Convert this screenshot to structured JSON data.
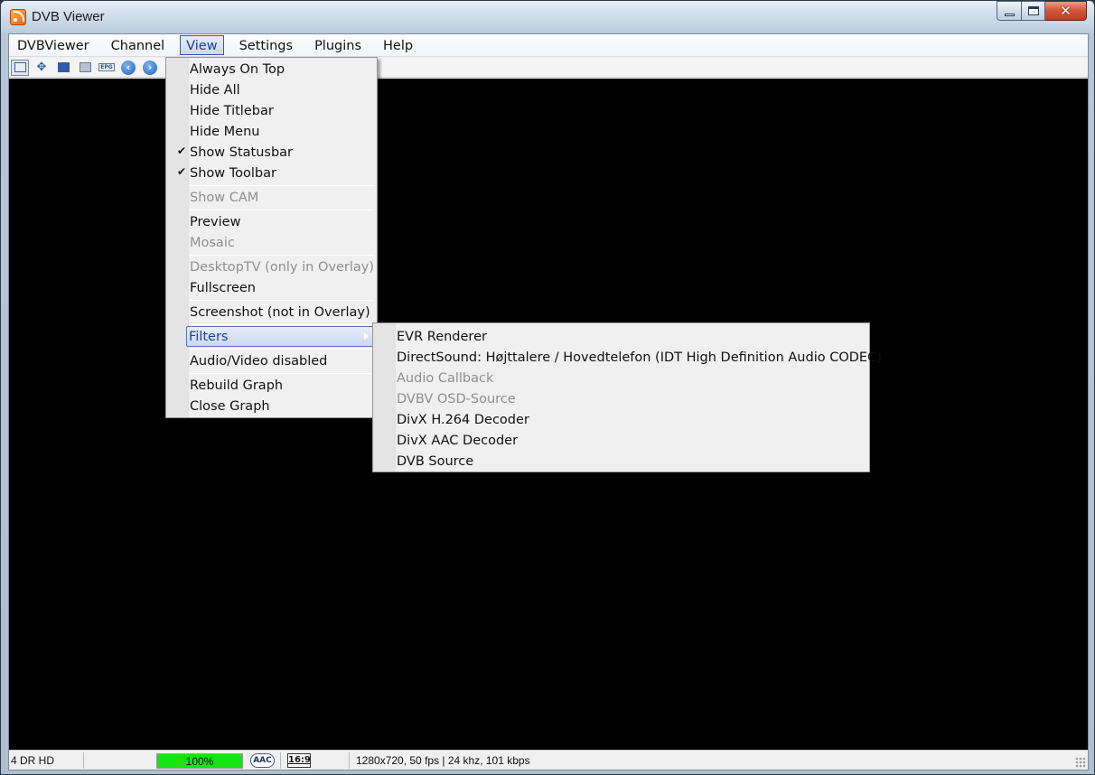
{
  "window": {
    "title": "DVB Viewer",
    "close_glyph": "✕"
  },
  "menubar": {
    "items": [
      {
        "label": "DVBViewer"
      },
      {
        "label": "Channel"
      },
      {
        "label": "View"
      },
      {
        "label": "Settings"
      },
      {
        "label": "Plugins"
      },
      {
        "label": "Help"
      }
    ]
  },
  "toolbar": {
    "epg_label": "EPG",
    "back_glyph": "‹",
    "forward_glyph": "›"
  },
  "view_menu": {
    "items": [
      {
        "label": "Always On Top",
        "checked": false,
        "disabled": false
      },
      {
        "label": "Hide All",
        "checked": false,
        "disabled": false
      },
      {
        "label": "Hide Titlebar",
        "checked": false,
        "disabled": false
      },
      {
        "label": "Hide Menu",
        "checked": false,
        "disabled": false
      },
      {
        "label": "Show Statusbar",
        "checked": true,
        "disabled": false
      },
      {
        "label": "Show Toolbar",
        "checked": true,
        "disabled": false
      },
      {
        "label": "Show CAM",
        "checked": false,
        "disabled": true
      },
      {
        "label": "Preview",
        "checked": false,
        "disabled": false
      },
      {
        "label": "Mosaic",
        "checked": false,
        "disabled": true
      },
      {
        "label": "DesktopTV (only in Overlay)",
        "checked": false,
        "disabled": true
      },
      {
        "label": "Fullscreen",
        "checked": false,
        "disabled": false
      },
      {
        "label": "Screenshot (not in Overlay)",
        "checked": false,
        "disabled": false
      },
      {
        "label": "Filters",
        "checked": false,
        "disabled": false,
        "submenu": true,
        "highlighted": true
      },
      {
        "label": "Audio/Video disabled",
        "checked": false,
        "disabled": false
      },
      {
        "label": "Rebuild Graph",
        "checked": false,
        "disabled": false
      },
      {
        "label": "Close Graph",
        "checked": false,
        "disabled": false
      }
    ],
    "check_glyph": "✔"
  },
  "filters_menu": {
    "items": [
      {
        "label": "EVR Renderer",
        "disabled": false
      },
      {
        "label": "DirectSound: Højttalere / Hovedtelefon (IDT High Definition Audio CODEC)",
        "disabled": false
      },
      {
        "label": "Audio Callback",
        "disabled": true
      },
      {
        "label": "DVBV OSD-Source",
        "disabled": true
      },
      {
        "label": "DivX H.264 Decoder",
        "disabled": false
      },
      {
        "label": "DivX AAC Decoder",
        "disabled": false
      },
      {
        "label": "DVB Source",
        "disabled": false
      }
    ]
  },
  "statusbar": {
    "channel": "4 DR HD",
    "signal_percent": "100%",
    "signal_level": 1.0,
    "audio_badge": "AAC",
    "aspect": "16:9",
    "info": "1280x720, 50 fps | 24 khz, 101 kbps"
  },
  "colors": {
    "signal_fill": "#17e217",
    "video_bg": "#000000",
    "menu_highlight": "#c9d8f2"
  }
}
